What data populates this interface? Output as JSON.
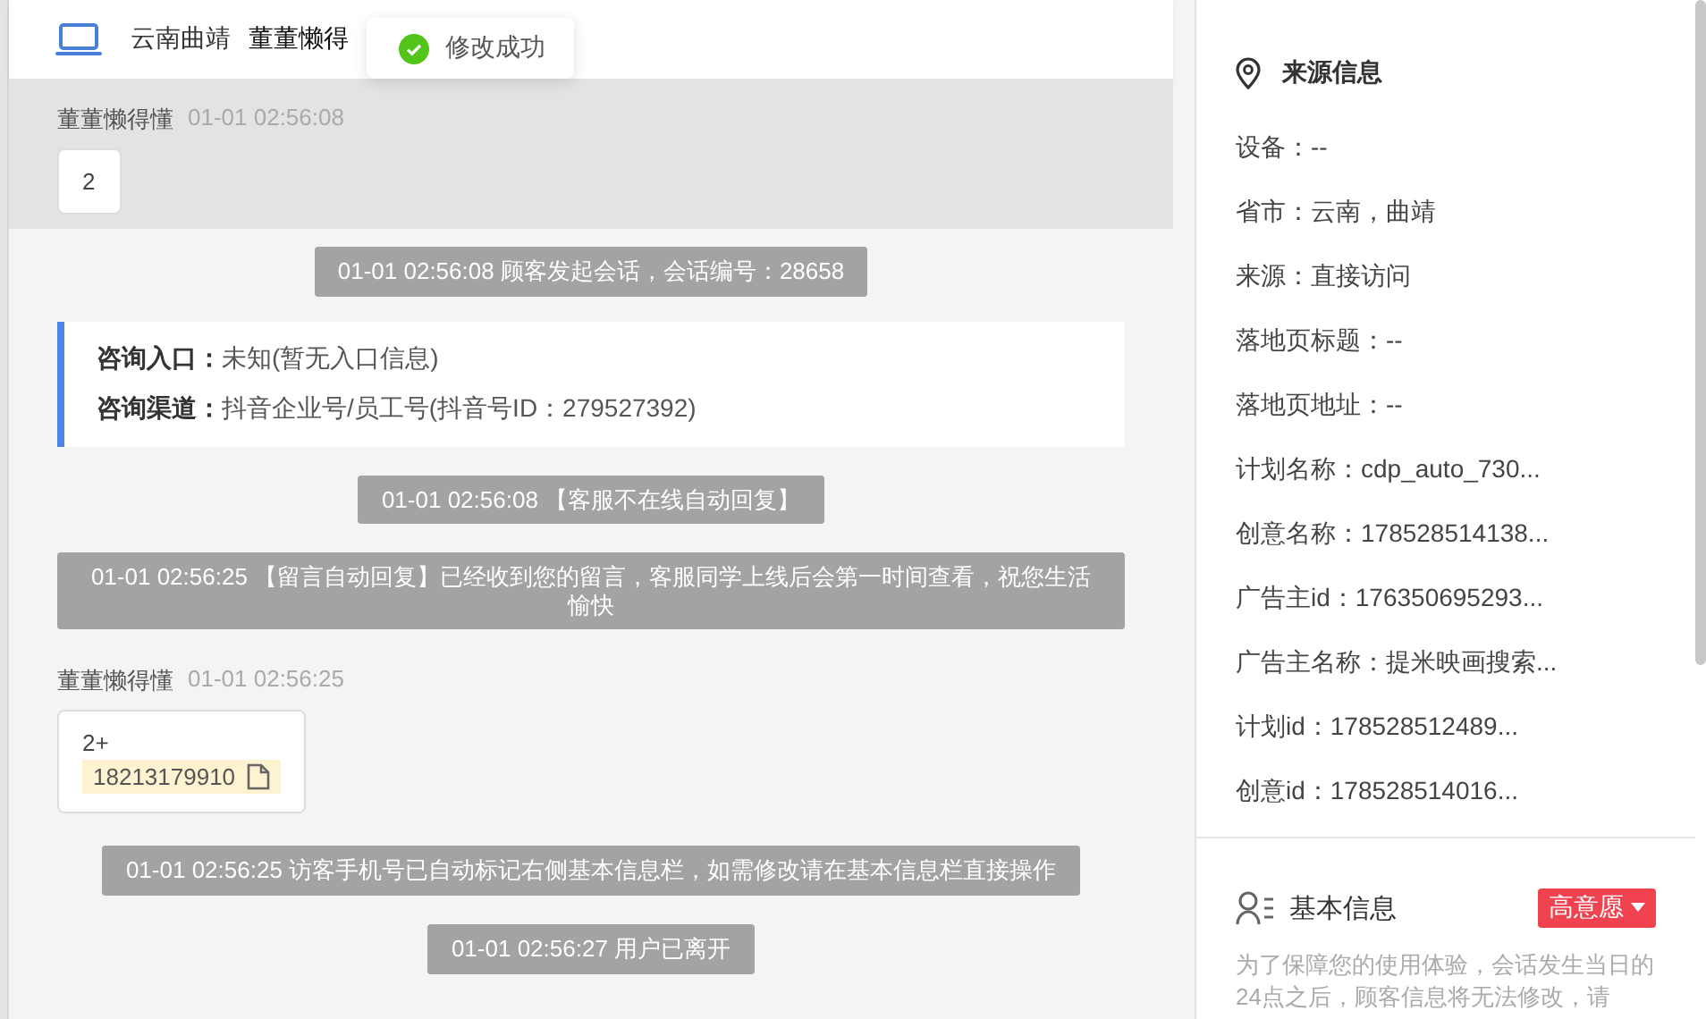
{
  "header": {
    "location": "云南曲靖",
    "name": "董董懒得"
  },
  "toast": {
    "text": "修改成功"
  },
  "messages": [
    {
      "kind": "user",
      "highlighted": true,
      "name": "董董懒得懂",
      "time": "01-01 02:56:08",
      "text": "2"
    },
    {
      "kind": "system",
      "text": "01-01 02:56:08 顾客发起会话，会话编号：28658"
    },
    {
      "kind": "info",
      "lines": [
        {
          "label": "咨询入口：",
          "value": "未知(暂无入口信息)"
        },
        {
          "label": "咨询渠道：",
          "value": "抖音企业号/员工号(抖音号ID：279527392)"
        }
      ]
    },
    {
      "kind": "system",
      "text": "01-01 02:56:08 【客服不在线自动回复】"
    },
    {
      "kind": "system",
      "text": "01-01 02:56:25 【留言自动回复】已经收到您的留言，客服同学上线后会第一时间查看，祝您生活愉快"
    },
    {
      "kind": "user",
      "highlighted": false,
      "name": "董董懒得懂",
      "time": "01-01 02:56:25",
      "text": "2+",
      "phone": "18213179910"
    },
    {
      "kind": "system",
      "text": "01-01 02:56:25 访客手机号已自动标记右侧基本信息栏，如需修改请在基本信息栏直接操作"
    },
    {
      "kind": "system",
      "text": "01-01 02:56:27 用户已离开"
    }
  ],
  "source_info": {
    "title": "来源信息",
    "fields": [
      "设备：--",
      "省市：云南，曲靖",
      "来源：直接访问",
      "落地页标题：--",
      "落地页地址：--",
      "计划名称：cdp_auto_730...",
      "创意名称：178528514138...",
      "广告主id：176350695293...",
      "广告主名称：提米映画搜索...",
      "计划id：178528512489...",
      "创意id：178528514016..."
    ]
  },
  "basic_info": {
    "title": "基本信息",
    "tag": "高意愿",
    "note": "为了保障您的使用体验，会话发生当日的24点之后，顾客信息将无法修改，请"
  }
}
